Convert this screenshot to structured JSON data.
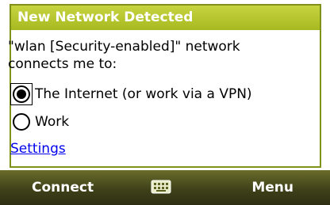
{
  "dialog": {
    "title": "New Network Detected",
    "message": "\"wlan [Security-enabled]\" network connects me to:",
    "options": [
      {
        "label": "The Internet (or work via a VPN)",
        "selected": true
      },
      {
        "label": "Work",
        "selected": false
      }
    ],
    "settings_link": "Settings"
  },
  "softkeys": {
    "left": "Connect",
    "right": "Menu",
    "center_icon": "keyboard-icon"
  },
  "colors": {
    "title_bar": "#b5c72d",
    "bottom_bar": "#45471d",
    "link": "#0000ee"
  }
}
